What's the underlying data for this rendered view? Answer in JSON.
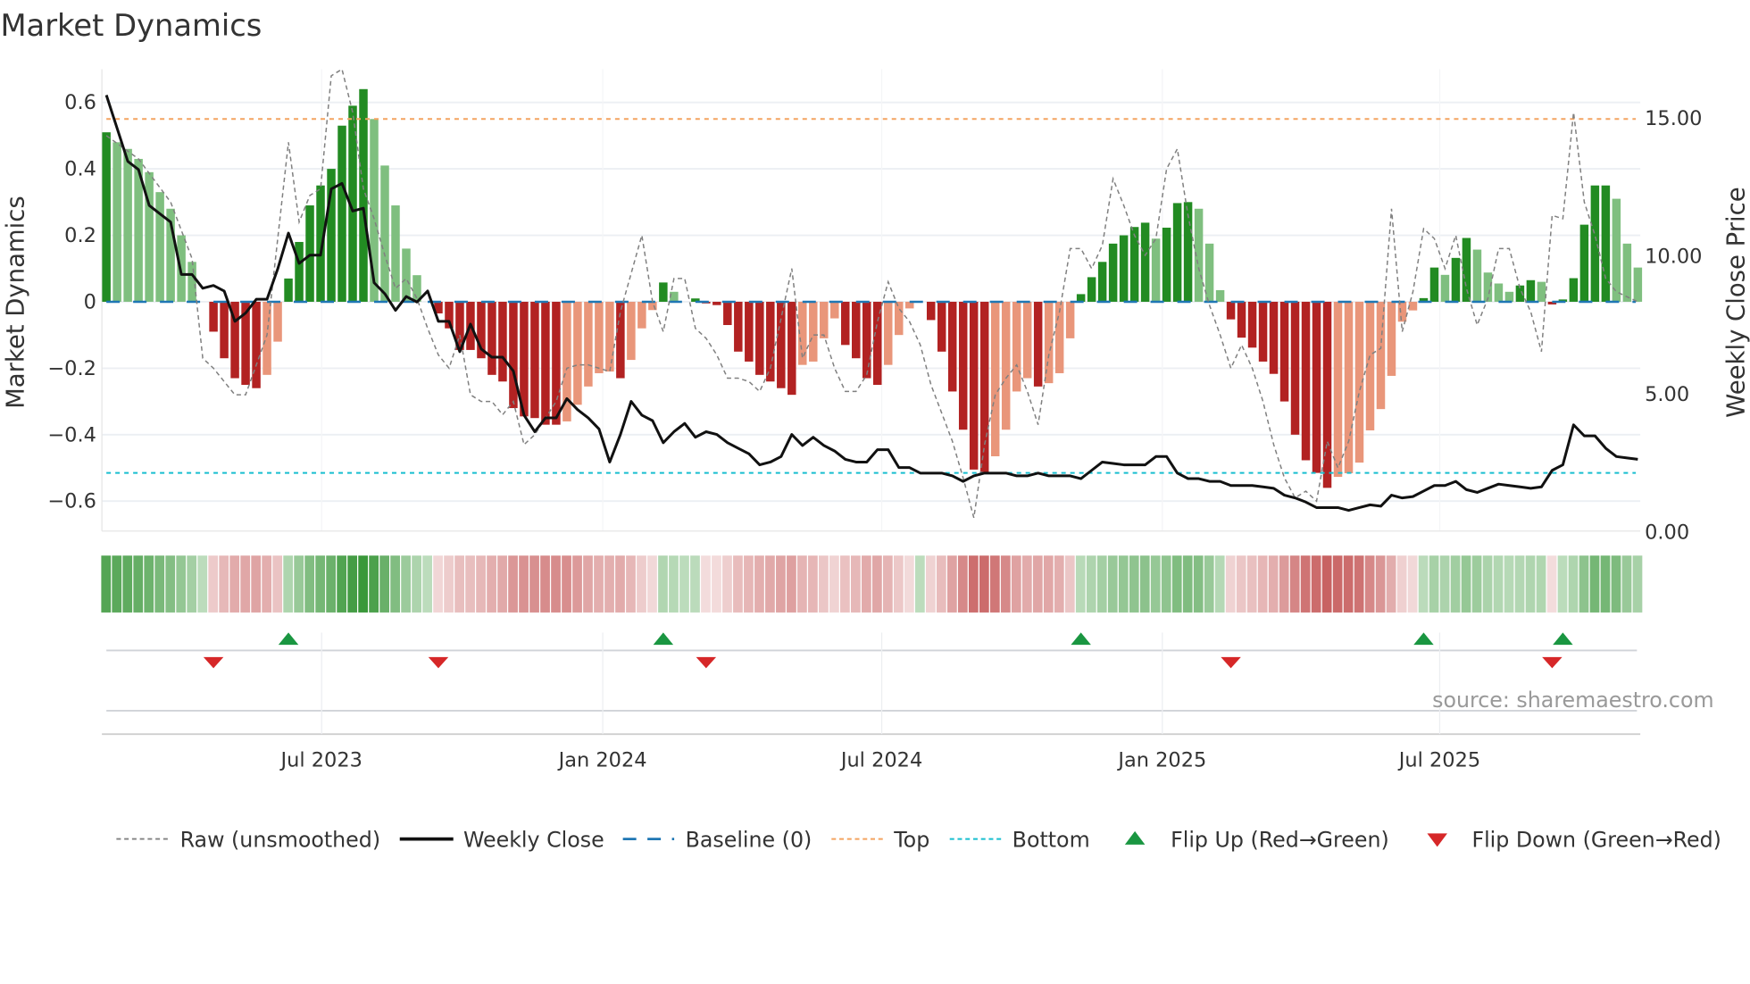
{
  "title": "Market Dynamics",
  "source": "source: sharemaestro.com",
  "colors": {
    "dark_green": "#228b22",
    "light_green": "#7fbf7f",
    "dark_red": "#b22222",
    "light_red": "#e9967a",
    "baseline": "#1f77b4",
    "top": "#f4a460",
    "bottom": "#17becf",
    "close": "#111111",
    "raw": "#808080",
    "flip_up": "#1a9641",
    "flip_down": "#d62728"
  },
  "chart_data": {
    "type": "bar",
    "title": "Market Dynamics",
    "ylabel": "Market Dynamics",
    "y2label": "Weekly Close Price",
    "ylim": [
      -0.69,
      0.7
    ],
    "y2lim": [
      0,
      16.74
    ],
    "yticks": [
      {
        "v": 0.6,
        "label": "0.6"
      },
      {
        "v": 0.4,
        "label": "0.4"
      },
      {
        "v": 0.2,
        "label": "0.2"
      },
      {
        "v": 0,
        "label": "0"
      },
      {
        "v": -0.2,
        "label": "−0.2"
      },
      {
        "v": -0.4,
        "label": "−0.4"
      },
      {
        "v": -0.6,
        "label": "−0.6"
      }
    ],
    "y2ticks": [
      {
        "v": 15,
        "label": "15.00"
      },
      {
        "v": 10,
        "label": "10.00"
      },
      {
        "v": 5,
        "label": "5.00"
      },
      {
        "v": 0,
        "label": "0.00"
      }
    ],
    "xticks": [
      {
        "week": 20.1,
        "label": "Jul 2023"
      },
      {
        "week": 46.35,
        "label": "Jan 2024"
      },
      {
        "week": 72.4,
        "label": "Jul 2024"
      },
      {
        "week": 98.6,
        "label": "Jan 2025"
      },
      {
        "week": 124.5,
        "label": "Jul 2025"
      }
    ],
    "top_level": 0.55,
    "bottom_level": -0.515,
    "baseline": 0,
    "dynamics": [
      0.51,
      0.48,
      0.46,
      0.43,
      0.39,
      0.33,
      0.28,
      0.2,
      0.12,
      0,
      -0.09,
      -0.17,
      -0.23,
      -0.25,
      -0.26,
      -0.22,
      -0.12,
      0.07,
      0.18,
      0.29,
      0.35,
      0.4,
      0.53,
      0.59,
      0.64,
      0.55,
      0.41,
      0.29,
      0.16,
      0.08,
      0,
      -0.035,
      -0.08,
      -0.145,
      -0.145,
      -0.17,
      -0.22,
      -0.24,
      -0.32,
      -0.345,
      -0.35,
      -0.37,
      -0.37,
      -0.36,
      -0.31,
      -0.255,
      -0.215,
      -0.21,
      -0.23,
      -0.175,
      -0.08,
      -0.025,
      0.058,
      0.03,
      0,
      0.01,
      -0.005,
      -0.01,
      -0.07,
      -0.15,
      -0.18,
      -0.22,
      -0.24,
      -0.26,
      -0.28,
      -0.19,
      -0.18,
      -0.11,
      -0.05,
      -0.13,
      -0.17,
      -0.23,
      -0.25,
      -0.19,
      -0.1,
      -0.02,
      0,
      -0.055,
      -0.15,
      -0.27,
      -0.385,
      -0.505,
      -0.515,
      -0.465,
      -0.385,
      -0.27,
      -0.23,
      -0.255,
      -0.245,
      -0.215,
      -0.11,
      0.023,
      0.074,
      0.12,
      0.175,
      0.2,
      0.225,
      0.238,
      0.19,
      0.223,
      0.297,
      0.3,
      0.28,
      0.175,
      0.035,
      -0.053,
      -0.108,
      -0.138,
      -0.18,
      -0.217,
      -0.3,
      -0.4,
      -0.477,
      -0.515,
      -0.56,
      -0.527,
      -0.516,
      -0.484,
      -0.387,
      -0.323,
      -0.223,
      -0.06,
      -0.026,
      0.011,
      0.103,
      0.081,
      0.132,
      0.192,
      0.157,
      0.088,
      0.055,
      0.03,
      0.049,
      0.065,
      0.06,
      -0.008,
      0.007,
      0.071,
      0.232,
      0.35,
      0.35,
      0.31,
      0.175,
      0.103
    ],
    "strong": [
      1,
      0,
      0,
      0,
      0,
      0,
      0,
      0,
      0,
      0,
      1,
      1,
      1,
      1,
      1,
      0,
      0,
      1,
      1,
      1,
      1,
      1,
      1,
      1,
      1,
      0,
      0,
      0,
      0,
      0,
      0,
      1,
      1,
      1,
      1,
      1,
      1,
      1,
      1,
      1,
      1,
      1,
      1,
      0,
      0,
      0,
      0,
      0,
      1,
      0,
      0,
      0,
      1,
      0,
      0,
      1,
      1,
      1,
      1,
      1,
      1,
      1,
      1,
      1,
      1,
      0,
      0,
      0,
      0,
      1,
      1,
      1,
      1,
      0,
      0,
      0,
      0,
      1,
      1,
      1,
      1,
      1,
      1,
      0,
      0,
      0,
      0,
      1,
      0,
      0,
      0,
      1,
      1,
      1,
      1,
      1,
      1,
      1,
      0,
      1,
      1,
      1,
      0,
      0,
      0,
      1,
      1,
      1,
      1,
      1,
      1,
      1,
      1,
      1,
      1,
      0,
      0,
      0,
      0,
      0,
      0,
      0,
      0,
      1,
      1,
      0,
      1,
      1,
      0,
      0,
      0,
      0,
      1,
      1,
      0,
      1,
      1,
      1,
      1,
      1,
      1,
      0,
      0,
      0
    ],
    "weekly_close": [
      15.8,
      14.6,
      13.4,
      13.1,
      11.8,
      11.5,
      11.2,
      9.3,
      9.3,
      8.8,
      8.9,
      8.7,
      7.6,
      7.9,
      8.4,
      8.4,
      9.5,
      10.8,
      9.7,
      10.0,
      10.0,
      12.4,
      12.6,
      11.6,
      11.7,
      9.0,
      8.6,
      8.0,
      8.5,
      8.3,
      8.7,
      7.6,
      7.6,
      6.5,
      7.5,
      6.6,
      6.3,
      6.3,
      5.8,
      4.2,
      3.6,
      4.1,
      4.1,
      4.8,
      4.4,
      4.1,
      3.7,
      2.5,
      3.5,
      4.7,
      4.2,
      4.0,
      3.2,
      3.6,
      3.9,
      3.4,
      3.6,
      3.5,
      3.2,
      3.0,
      2.8,
      2.4,
      2.5,
      2.7,
      3.5,
      3.1,
      3.4,
      3.1,
      2.9,
      2.6,
      2.5,
      2.5,
      2.95,
      2.95,
      2.3,
      2.3,
      2.1,
      2.1,
      2.1,
      2.0,
      1.8,
      2.0,
      2.1,
      2.1,
      2.1,
      2.0,
      2.0,
      2.1,
      2.0,
      2.0,
      2.0,
      1.9,
      2.2,
      2.5,
      2.45,
      2.4,
      2.4,
      2.4,
      2.7,
      2.7,
      2.1,
      1.9,
      1.9,
      1.8,
      1.8,
      1.65,
      1.65,
      1.65,
      1.6,
      1.55,
      1.3,
      1.2,
      1.05,
      0.85,
      0.85,
      0.85,
      0.75,
      0.85,
      0.95,
      0.9,
      1.3,
      1.2,
      1.25,
      1.45,
      1.65,
      1.65,
      1.8,
      1.5,
      1.4,
      1.55,
      1.7,
      1.65,
      1.6,
      1.55,
      1.6,
      2.2,
      2.4,
      3.85,
      3.45,
      3.45,
      3.0,
      2.7,
      2.65,
      2.6
    ],
    "raw_points": [
      [
        0,
        0.5
      ],
      [
        3,
        0.43
      ],
      [
        6,
        0.3
      ],
      [
        8,
        0.13
      ],
      [
        9,
        -0.17
      ],
      [
        10,
        -0.2
      ],
      [
        12,
        -0.28
      ],
      [
        13,
        -0.28
      ],
      [
        15,
        -0.1
      ],
      [
        17,
        0.48
      ],
      [
        18,
        0.24
      ],
      [
        19,
        0.32
      ],
      [
        20,
        0.34
      ],
      [
        21,
        0.68
      ],
      [
        22,
        0.7
      ],
      [
        23,
        0.57
      ],
      [
        24,
        0.34
      ],
      [
        25,
        0.25
      ],
      [
        26,
        0.14
      ],
      [
        27,
        0.04
      ],
      [
        28,
        0.07
      ],
      [
        29,
        0.01
      ],
      [
        30,
        -0.08
      ],
      [
        31,
        -0.16
      ],
      [
        32,
        -0.2
      ],
      [
        33,
        -0.1
      ],
      [
        34,
        -0.28
      ],
      [
        35,
        -0.3
      ],
      [
        36,
        -0.3
      ],
      [
        37,
        -0.34
      ],
      [
        38,
        -0.3
      ],
      [
        39,
        -0.43
      ],
      [
        40,
        -0.4
      ],
      [
        41,
        -0.35
      ],
      [
        42,
        -0.3
      ],
      [
        43,
        -0.2
      ],
      [
        44,
        -0.19
      ],
      [
        45,
        -0.19
      ],
      [
        46,
        -0.2
      ],
      [
        47,
        -0.21
      ],
      [
        48,
        -0.03
      ],
      [
        50,
        0.2
      ],
      [
        51,
        0
      ],
      [
        52,
        -0.09
      ],
      [
        53,
        0.07
      ],
      [
        54,
        0.07
      ],
      [
        55,
        -0.08
      ],
      [
        56,
        -0.11
      ],
      [
        57,
        -0.16
      ],
      [
        58,
        -0.23
      ],
      [
        59,
        -0.23
      ],
      [
        60,
        -0.24
      ],
      [
        61,
        -0.27
      ],
      [
        62,
        -0.2
      ],
      [
        64,
        0.1
      ],
      [
        65,
        -0.17
      ],
      [
        66,
        -0.1
      ],
      [
        67,
        -0.1
      ],
      [
        68,
        -0.2
      ],
      [
        69,
        -0.27
      ],
      [
        70,
        -0.27
      ],
      [
        71,
        -0.22
      ],
      [
        72,
        -0.06
      ],
      [
        73,
        0.06
      ],
      [
        74,
        -0.02
      ],
      [
        75,
        -0.06
      ],
      [
        76,
        -0.13
      ],
      [
        77,
        -0.25
      ],
      [
        79,
        -0.42
      ],
      [
        80,
        -0.53
      ],
      [
        81,
        -0.65
      ],
      [
        82,
        -0.43
      ],
      [
        83,
        -0.28
      ],
      [
        84,
        -0.23
      ],
      [
        85,
        -0.19
      ],
      [
        86,
        -0.27
      ],
      [
        87,
        -0.37
      ],
      [
        88,
        -0.16
      ],
      [
        89,
        -0.03
      ],
      [
        90,
        0.16
      ],
      [
        91,
        0.16
      ],
      [
        92,
        0.1
      ],
      [
        93,
        0.17
      ],
      [
        94,
        0.37
      ],
      [
        95,
        0.29
      ],
      [
        96,
        0.2
      ],
      [
        97,
        0.14
      ],
      [
        98,
        0.19
      ],
      [
        99,
        0.4
      ],
      [
        100,
        0.46
      ],
      [
        101,
        0.26
      ],
      [
        102,
        0.1
      ],
      [
        103,
        -0.01
      ],
      [
        104,
        -0.1
      ],
      [
        105,
        -0.2
      ],
      [
        106,
        -0.13
      ],
      [
        107,
        -0.2
      ],
      [
        108,
        -0.3
      ],
      [
        109,
        -0.43
      ],
      [
        110,
        -0.53
      ],
      [
        111,
        -0.59
      ],
      [
        112,
        -0.57
      ],
      [
        113,
        -0.6
      ],
      [
        114,
        -0.42
      ],
      [
        115,
        -0.5
      ],
      [
        116,
        -0.42
      ],
      [
        117,
        -0.27
      ],
      [
        118,
        -0.16
      ],
      [
        119,
        -0.14
      ],
      [
        120,
        0.28
      ],
      [
        121,
        -0.09
      ],
      [
        122,
        0.03
      ],
      [
        123,
        0.22
      ],
      [
        124,
        0.19
      ],
      [
        125,
        0.1
      ],
      [
        126,
        0.2
      ],
      [
        127,
        0.04
      ],
      [
        128,
        -0.07
      ],
      [
        129,
        0.01
      ],
      [
        130,
        0.16
      ],
      [
        131,
        0.16
      ],
      [
        132,
        0.04
      ],
      [
        133,
        -0.03
      ],
      [
        134,
        -0.15
      ],
      [
        135,
        0.26
      ],
      [
        136,
        0.25
      ],
      [
        137,
        0.57
      ],
      [
        138,
        0.3
      ],
      [
        139,
        0.2
      ],
      [
        140,
        0.07
      ],
      [
        141,
        0.03
      ],
      [
        143,
        0.0
      ]
    ],
    "flip_up_weeks": [
      17,
      52,
      91,
      123,
      136
    ],
    "flip_down_weeks": [
      10,
      31,
      56,
      105,
      135
    ],
    "legend": {
      "placement": "bottom",
      "items": [
        {
          "key": "raw",
          "label": "Raw (unsmoothed)"
        },
        {
          "key": "close",
          "label": "Weekly Close"
        },
        {
          "key": "baseline",
          "label": "Baseline (0)"
        },
        {
          "key": "top",
          "label": "Top"
        },
        {
          "key": "bottom",
          "label": "Bottom"
        },
        {
          "key": "up",
          "label": "Flip Up (Red→Green)"
        },
        {
          "key": "down",
          "label": "Flip Down (Green→Red)"
        }
      ]
    }
  }
}
